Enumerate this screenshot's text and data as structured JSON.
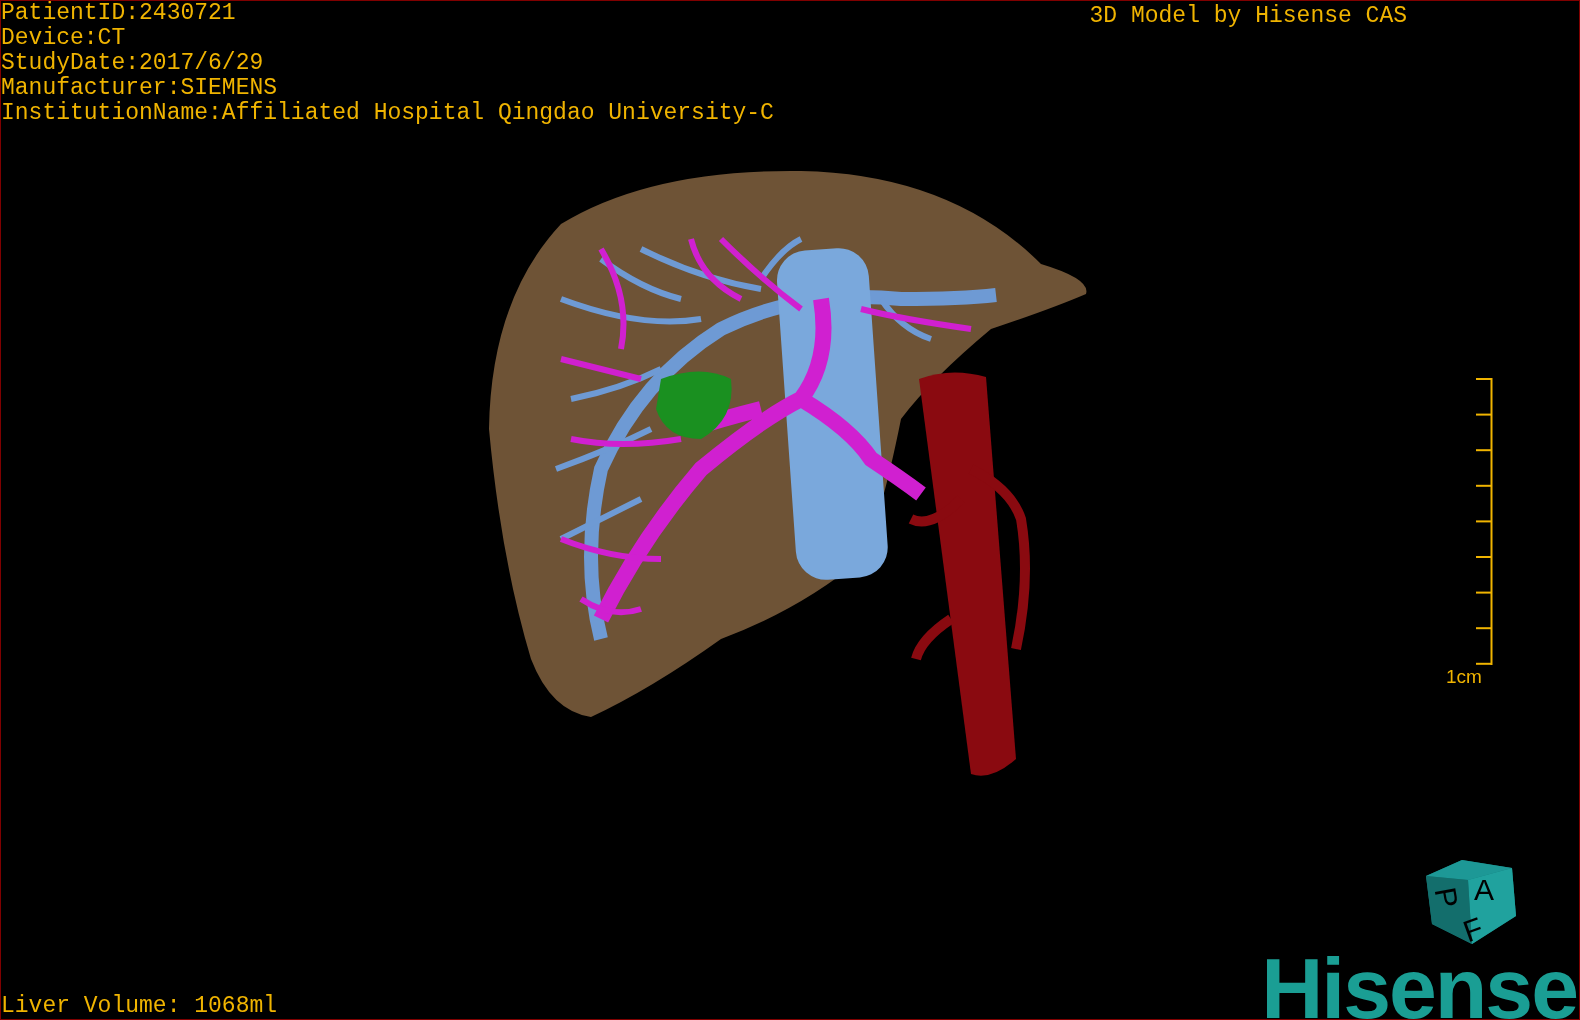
{
  "info_lines": [
    "PatientID:2430721",
    "Device:CT",
    "StudyDate:2017/6/29",
    "Manufacturer:SIEMENS",
    "InstitutionName:Affiliated Hospital Qingdao University-C"
  ],
  "title": "3D Model by Hisense CAS",
  "scale": {
    "label": "1cm"
  },
  "orientation_cube": {
    "faces": [
      {
        "kind": "front",
        "letter": "A"
      },
      {
        "kind": "left",
        "letter": "P"
      },
      {
        "kind": "bottom",
        "letter": "F"
      }
    ]
  },
  "liver_volume": "Liver Volume: 1068ml",
  "logo": "Hisense"
}
